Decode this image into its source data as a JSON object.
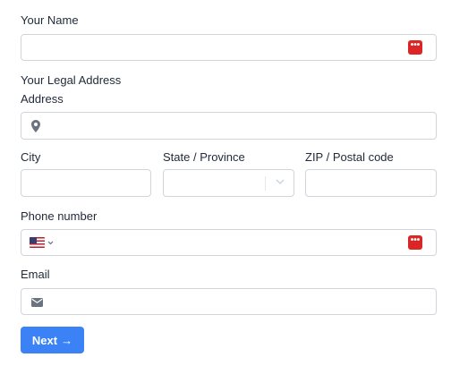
{
  "fields": {
    "name": {
      "label": "Your Name",
      "value": "",
      "placeholder": ""
    },
    "legal_address_heading": "Your Legal Address",
    "address": {
      "label": "Address",
      "value": "",
      "placeholder": ""
    },
    "city": {
      "label": "City",
      "value": "",
      "placeholder": ""
    },
    "state": {
      "label": "State / Province",
      "selected": ""
    },
    "zip": {
      "label": "ZIP / Postal code",
      "value": "",
      "placeholder": ""
    },
    "phone": {
      "label": "Phone number",
      "value": "",
      "placeholder": "",
      "country": "US"
    },
    "email": {
      "label": "Email",
      "value": "",
      "placeholder": ""
    }
  },
  "icons": {
    "password_manager": "password-manager-icon",
    "password_manager_glyph": "•••",
    "pin": "map-pin-icon",
    "chevron": "chevron-down-icon",
    "flag": "us-flag-icon",
    "mail": "envelope-icon"
  },
  "button": {
    "label": "Next",
    "arrow": "→"
  },
  "colors": {
    "accent": "#3b82f6",
    "password_manager": "#dc2626",
    "border": "#d1d5db"
  }
}
